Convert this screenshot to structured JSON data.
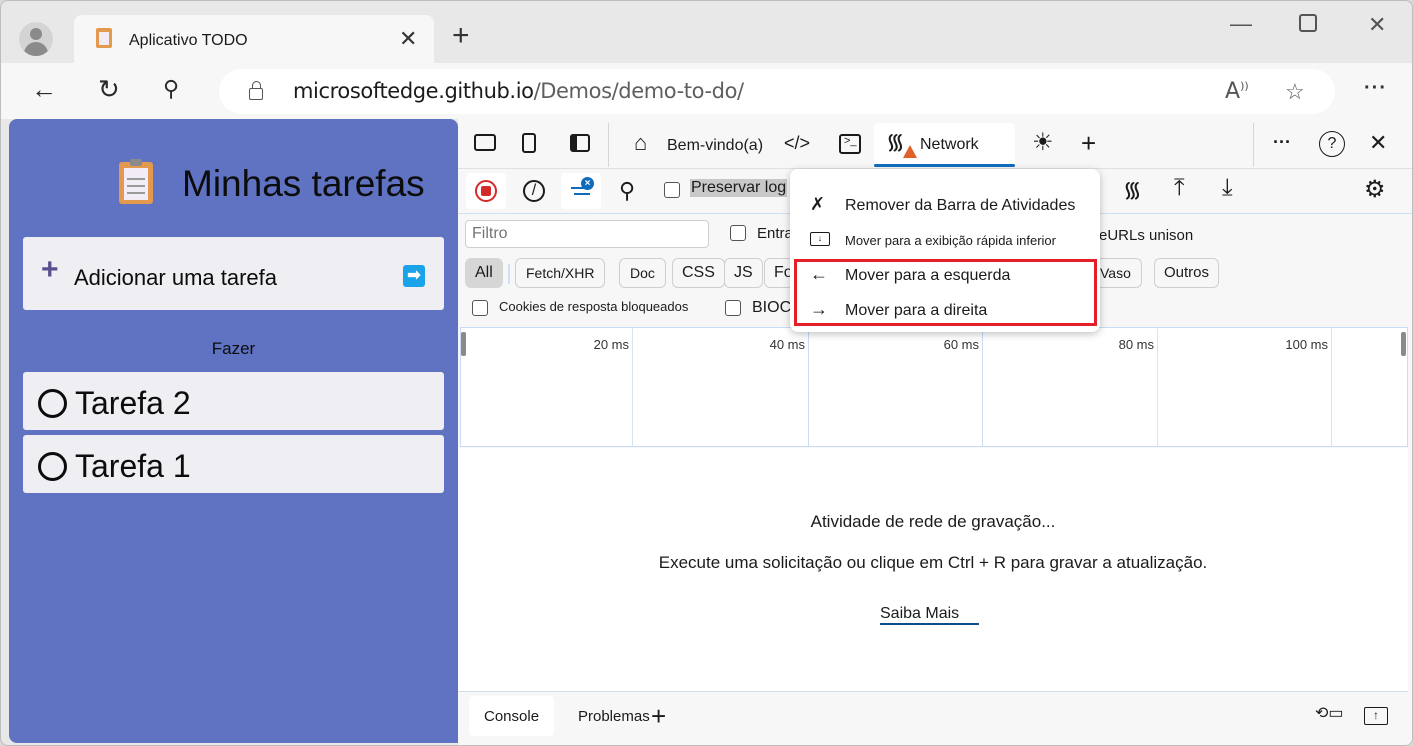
{
  "browser": {
    "tab_title": "Aplicativo TODO",
    "tab_close_icon": "close-icon",
    "new_tab_icon": "plus-icon",
    "window_controls": [
      "minimize-icon",
      "maximize-icon",
      "close-icon"
    ],
    "url_host": "microsoftedge.github.io",
    "url_path": "/Demos/demo-to-do/",
    "nav_icons": [
      "back-arrow-icon",
      "refresh-icon",
      "search-icon"
    ],
    "address_icons": [
      "read-aloud-icon",
      "favorite-star-icon"
    ],
    "more_label": "···"
  },
  "todo": {
    "title": "Minhas tarefas",
    "add_task_label": "Adicionar uma tarefa",
    "section_label": "Fazer",
    "tasks": [
      {
        "label": "Tarefa 2",
        "done": false
      },
      {
        "label": "Tarefa 1",
        "done": false
      }
    ],
    "accent_color": "#5f73c2"
  },
  "devtools": {
    "tabs": {
      "welcome": "Bem-vindo(a)",
      "network": "Network"
    },
    "toolbar": {
      "preserve_log": "Preservar log"
    },
    "filter": {
      "placeholder": "Filtro",
      "entrada_label": "Entrada",
      "urls_label": "eURLs unison"
    },
    "types": [
      "All",
      "Fetch/XHR",
      "Doc",
      "CSS",
      "JS",
      "Fo",
      "Vaso",
      "Outros"
    ],
    "cookies_label": "Cookies de resposta bloqueados",
    "bloc_label": "BIOCI",
    "timeline_ticks": [
      "20 ms",
      "40 ms",
      "60 ms",
      "80 ms",
      "100 ms"
    ],
    "empty_state": {
      "title": "Atividade de rede de gravação...",
      "hint": "Execute uma solicitação ou clique em Ctrl + R para gravar a atualização.",
      "learn_more": "Saiba Mais"
    },
    "drawer": {
      "tabs": [
        "Console",
        "Problemas"
      ]
    },
    "context_menu": {
      "items": [
        {
          "label": "Remover da Barra de Atividades",
          "icon": "unpin-icon"
        },
        {
          "label": "Mover para a exibição rápida inferior",
          "icon": "move-to-bottom-icon"
        },
        {
          "label": "Mover para a esquerda",
          "icon": "arrow-left-icon"
        },
        {
          "label": "Mover para a direita",
          "icon": "arrow-right-icon"
        }
      ],
      "highlight_color": "#e3202a"
    },
    "accent_color": "#0f6cbd"
  }
}
